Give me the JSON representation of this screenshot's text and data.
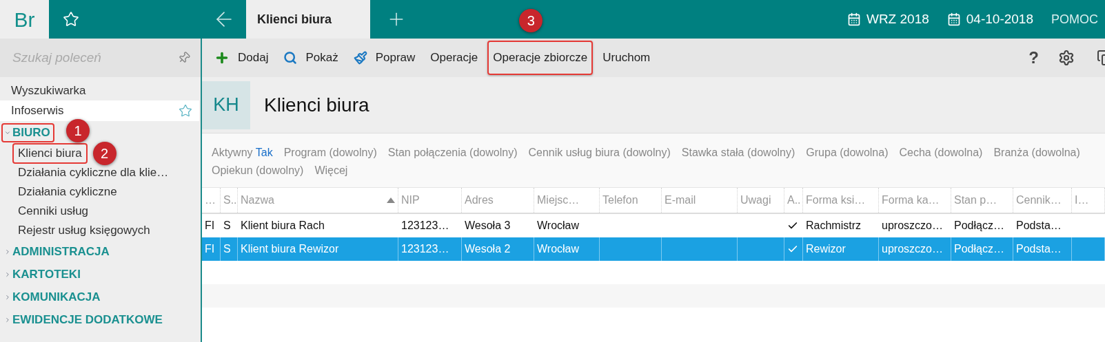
{
  "app": {
    "logo": "Br"
  },
  "tabs": [
    {
      "label": "Klienci biura",
      "selected": true
    }
  ],
  "header_right": [
    {
      "kind": "calendar",
      "label": "WRZ 2018"
    },
    {
      "kind": "calendar",
      "label": "04-10-2018"
    },
    {
      "kind": "link",
      "label": "POMOC"
    }
  ],
  "sidebar": {
    "search": {
      "placeholder": "Szukaj poleceń"
    },
    "items": [
      {
        "label": "Wyszukiwarka",
        "kind": "item",
        "hovered": false
      },
      {
        "label": "Infoserwis",
        "kind": "item",
        "hovered": true
      },
      {
        "label": "BIURO",
        "kind": "group",
        "expanded": true,
        "highlighted": true,
        "callout": "1",
        "children": [
          {
            "label": "Klienci biura",
            "kind": "item",
            "hovered": false,
            "highlighted": true,
            "callout": "2"
          },
          {
            "label": "Działania cykliczne dla klie…",
            "kind": "item",
            "hovered": false
          },
          {
            "label": "Działania cykliczne",
            "kind": "item",
            "hovered": false
          },
          {
            "label": "Cenniki usług",
            "kind": "item",
            "hovered": false
          },
          {
            "label": "Rejestr usług księgowych",
            "kind": "item",
            "hovered": false
          }
        ]
      },
      {
        "label": "ADMINISTRACJA",
        "kind": "group",
        "expanded": false
      },
      {
        "label": "KARTOTEKI",
        "kind": "group",
        "expanded": false
      },
      {
        "label": "KOMUNIKACJA",
        "kind": "group",
        "expanded": false
      },
      {
        "label": "EWIDENCJE DODATKOWE",
        "kind": "group",
        "expanded": false
      }
    ]
  },
  "toolbar": {
    "buttons": [
      {
        "label": "Dodaj",
        "kind": "add"
      },
      {
        "label": "Pokaż",
        "kind": "search"
      },
      {
        "label": "Popraw",
        "kind": "edit"
      },
      {
        "label": "Operacje",
        "kind": "plain"
      },
      {
        "label": "Operacje zbiorcze",
        "kind": "plain",
        "highlighted": true,
        "callout": "3"
      },
      {
        "label": "Uruchom",
        "kind": "plain"
      }
    ],
    "help": "?"
  },
  "page": {
    "badge": "KH",
    "title": "Klienci biura"
  },
  "filters": [
    {
      "label": "Aktywny",
      "value": "Tak"
    },
    {
      "label": "Program (dowolny)"
    },
    {
      "label": "Stan połączenia (dowolny)"
    },
    {
      "label": "Cennik usług biura (dowolny)"
    },
    {
      "label": "Stawka stała (dowolny)"
    },
    {
      "label": "Grupa (dowolna)"
    },
    {
      "label": "Cecha (dowolna)"
    },
    {
      "label": "Branża (dowolna)"
    },
    {
      "label": "Opiekun (dowolny)"
    },
    {
      "label": "Więcej"
    }
  ],
  "table": {
    "columns": [
      {
        "label": "…"
      },
      {
        "label": "S.."
      },
      {
        "label": "Nazwa",
        "sorted": true
      },
      {
        "label": "NIP"
      },
      {
        "label": "Adres"
      },
      {
        "label": "Miejsc…"
      },
      {
        "label": "Telefon"
      },
      {
        "label": "E-mail"
      },
      {
        "label": "Uwagi"
      },
      {
        "label": "A.."
      },
      {
        "label": "Forma ksi…"
      },
      {
        "label": "Forma ka…"
      },
      {
        "label": "Stan p…"
      },
      {
        "label": "Cennik…"
      },
      {
        "label": "I…"
      }
    ],
    "rows": [
      {
        "selected": false,
        "checked": true,
        "cells": [
          "FI",
          "S",
          "Klient biura Rach",
          "123123…",
          "Wesoła 3",
          "Wrocław",
          null,
          null,
          null,
          null,
          "Rachmistrz",
          "uproszczo…",
          "Podłącz…",
          "Podsta…",
          null
        ]
      },
      {
        "selected": true,
        "checked": true,
        "cells": [
          "FI",
          "S",
          "Klient biura Rewizor",
          "123123…",
          "Wesoła 2",
          "Wrocław",
          null,
          null,
          null,
          null,
          "Rewizor",
          "uproszczo…",
          "Podłącz…",
          "Podsta…",
          null
        ]
      }
    ]
  }
}
